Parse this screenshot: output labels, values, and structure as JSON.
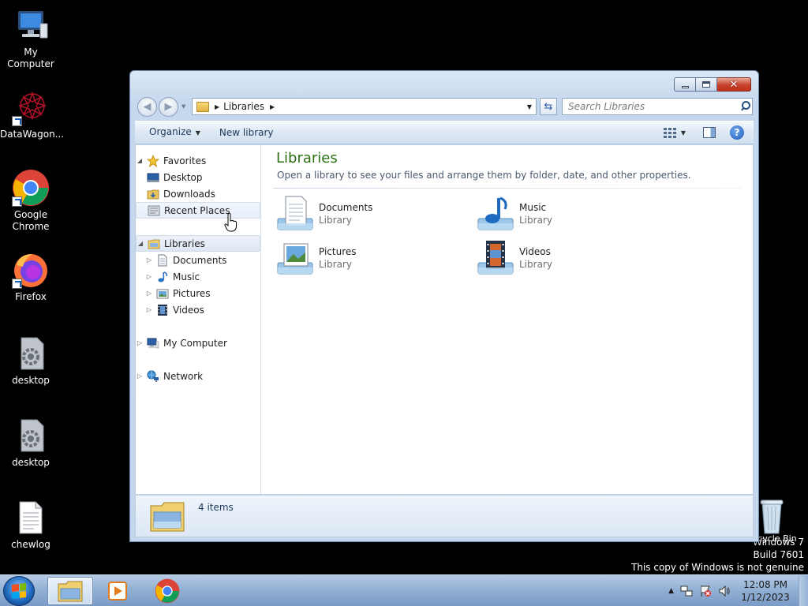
{
  "desktop": {
    "icons": [
      {
        "label": "My Computer"
      },
      {
        "label": "DataWagon..."
      },
      {
        "label": "Google Chrome"
      },
      {
        "label": "Firefox"
      },
      {
        "label": "desktop"
      },
      {
        "label": "desktop"
      },
      {
        "label": "chewlog"
      }
    ],
    "recycle_bin": "Recycle Bin",
    "watermark": {
      "line1": "Windows 7",
      "line2": "Build 7601",
      "line3": "This copy of Windows is not genuine"
    }
  },
  "window": {
    "address": {
      "crumb": "Libraries"
    },
    "search": {
      "placeholder": "Search Libraries"
    },
    "toolbar": {
      "organize": "Organize",
      "new_library": "New library"
    },
    "nav": {
      "favorites": "Favorites",
      "desktop": "Desktop",
      "downloads": "Downloads",
      "recent_places": "Recent Places",
      "libraries": "Libraries",
      "documents": "Documents",
      "music": "Music",
      "pictures": "Pictures",
      "videos": "Videos",
      "my_computer": "My Computer",
      "network": "Network"
    },
    "main": {
      "title": "Libraries",
      "description": "Open a library to see your files and arrange them by folder, date, and other properties.",
      "tiles": [
        {
          "name": "Documents",
          "type": "Library"
        },
        {
          "name": "Music",
          "type": "Library"
        },
        {
          "name": "Pictures",
          "type": "Library"
        },
        {
          "name": "Videos",
          "type": "Library"
        }
      ]
    },
    "status": {
      "items": "4 items"
    }
  },
  "taskbar": {
    "clock": {
      "time": "12:08 PM",
      "date": "1/12/2023"
    }
  },
  "colors": {
    "library_title": "#2a6f12",
    "taskbar": "#93b1d4",
    "close_button": "#c8432c"
  }
}
